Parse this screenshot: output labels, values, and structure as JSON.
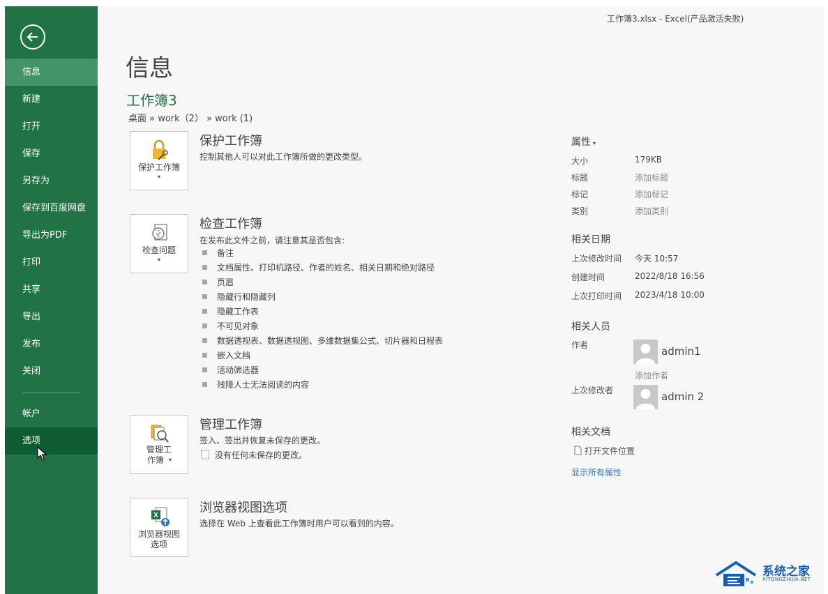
{
  "window": {
    "title": "工作簿3.xlsx - Excel(产品激活失败)"
  },
  "sidebar": {
    "items": [
      {
        "label": "信息"
      },
      {
        "label": "新建"
      },
      {
        "label": "打开"
      },
      {
        "label": "保存"
      },
      {
        "label": "另存为"
      },
      {
        "label": "保存到百度网盘"
      },
      {
        "label": "导出为PDF"
      },
      {
        "label": "打印"
      },
      {
        "label": "共享"
      },
      {
        "label": "导出"
      },
      {
        "label": "发布"
      },
      {
        "label": "关闭"
      },
      {
        "label": "帐户"
      },
      {
        "label": "选项"
      }
    ],
    "active": "信息",
    "hovered": "选项"
  },
  "main": {
    "title": "信息",
    "workbook_name": "工作簿3",
    "path": "桌面 » work（2） » work (1)",
    "protect": {
      "button_label": "保护工作簿",
      "title": "保护工作簿",
      "desc": "控制其他人可以对此工作簿所做的更改类型。"
    },
    "inspect": {
      "button_label": "检查问题",
      "title": "检查工作簿",
      "desc": "在发布此文件之前，请注意其是否包含:",
      "bullets": [
        "备注",
        "文档属性、打印机路径、作者的姓名、相关日期和绝对路径",
        "页眉",
        "隐藏行和隐藏列",
        "隐藏工作表",
        "不可见对象",
        "数据透视表、数据透视图、多维数据集公式、切片器和日程表",
        "嵌入文档",
        "活动筛选器",
        "残障人士无法阅读的内容"
      ]
    },
    "manage": {
      "button_label_1": "管理工",
      "button_label_2": "作簿",
      "title": "管理工作簿",
      "desc": "签入、签出并恢复未保存的更改。",
      "note": "没有任何未保存的更改。"
    },
    "browser": {
      "button_label_1": "浏览器视图",
      "button_label_2": "选项",
      "title": "浏览器视图选项",
      "desc": "选择在 Web 上查看此工作簿时用户可以看到的内容。"
    }
  },
  "properties": {
    "heading": "属性",
    "size_label": "大小",
    "size_value": "179KB",
    "title_label": "标题",
    "title_value": "添加标题",
    "tags_label": "标记",
    "tags_value": "添加标记",
    "category_label": "类别",
    "category_value": "添加类别",
    "dates_heading": "相关日期",
    "modified_label": "上次修改时间",
    "modified_value": "今天 10:57",
    "created_label": "创建时间",
    "created_value": "2022/8/18 16:56",
    "printed_label": "上次打印时间",
    "printed_value": "2023/4/18 10:00",
    "people_heading": "相关人员",
    "author_label": "作者",
    "author_name": "admin1",
    "add_author": "添加作者",
    "last_modified_by_label": "上次修改者",
    "last_modified_by_name": "admin 2",
    "docs_heading": "相关文档",
    "open_location": "打开文件位置",
    "show_all": "显示所有属性"
  },
  "watermark": {
    "cn": "系统之家",
    "en": "XITONGZHIJIA.NET"
  },
  "colors": {
    "accent": "#217346",
    "active_nav": "#439467",
    "hover_nav": "#0f5c33",
    "link": "#2e75b6"
  }
}
